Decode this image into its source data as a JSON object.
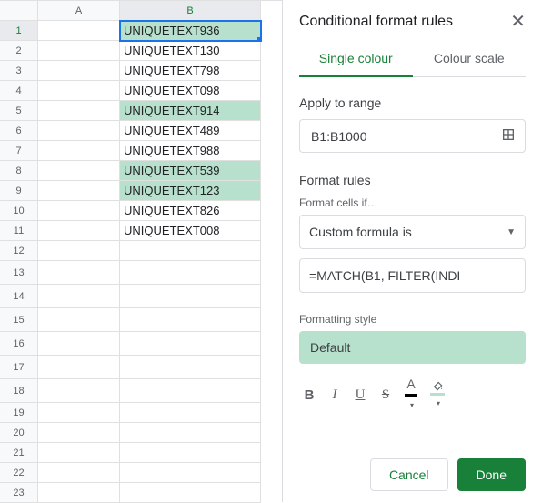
{
  "columns": [
    "A",
    "B"
  ],
  "rows": [
    {
      "n": 1,
      "b": "UNIQUETEXT936",
      "hl": true,
      "sel": true
    },
    {
      "n": 2,
      "b": "UNIQUETEXT130",
      "hl": false
    },
    {
      "n": 3,
      "b": "UNIQUETEXT798",
      "hl": false
    },
    {
      "n": 4,
      "b": "UNIQUETEXT098",
      "hl": false
    },
    {
      "n": 5,
      "b": "UNIQUETEXT914",
      "hl": true
    },
    {
      "n": 6,
      "b": "UNIQUETEXT489",
      "hl": false
    },
    {
      "n": 7,
      "b": "UNIQUETEXT988",
      "hl": false
    },
    {
      "n": 8,
      "b": "UNIQUETEXT539",
      "hl": true
    },
    {
      "n": 9,
      "b": "UNIQUETEXT123",
      "hl": true
    },
    {
      "n": 10,
      "b": "UNIQUETEXT826",
      "hl": false
    },
    {
      "n": 11,
      "b": "UNIQUETEXT008",
      "hl": false
    },
    {
      "n": 12,
      "b": "",
      "hl": false
    },
    {
      "n": 13,
      "b": "",
      "hl": false,
      "tall": true
    },
    {
      "n": 14,
      "b": "",
      "hl": false,
      "tall": true
    },
    {
      "n": 15,
      "b": "",
      "hl": false,
      "tall": true
    },
    {
      "n": 16,
      "b": "",
      "hl": false,
      "tall": true
    },
    {
      "n": 17,
      "b": "",
      "hl": false,
      "tall": true
    },
    {
      "n": 18,
      "b": "",
      "hl": false,
      "tall": true
    },
    {
      "n": 19,
      "b": "",
      "hl": false
    },
    {
      "n": 20,
      "b": "",
      "hl": false
    },
    {
      "n": 21,
      "b": "",
      "hl": false
    },
    {
      "n": 22,
      "b": "",
      "hl": false
    },
    {
      "n": 23,
      "b": "",
      "hl": false
    }
  ],
  "panel": {
    "title": "Conditional format rules",
    "tab_single": "Single colour",
    "tab_scale": "Colour scale",
    "apply_label": "Apply to range",
    "range_value": "B1:B1000",
    "rules_label": "Format rules",
    "cells_if_label": "Format cells if…",
    "condition": "Custom formula is",
    "formula": "=MATCH(B1, FILTER(INDI",
    "style_label": "Formatting style",
    "style_preview": "Default",
    "cancel": "Cancel",
    "done": "Done"
  }
}
